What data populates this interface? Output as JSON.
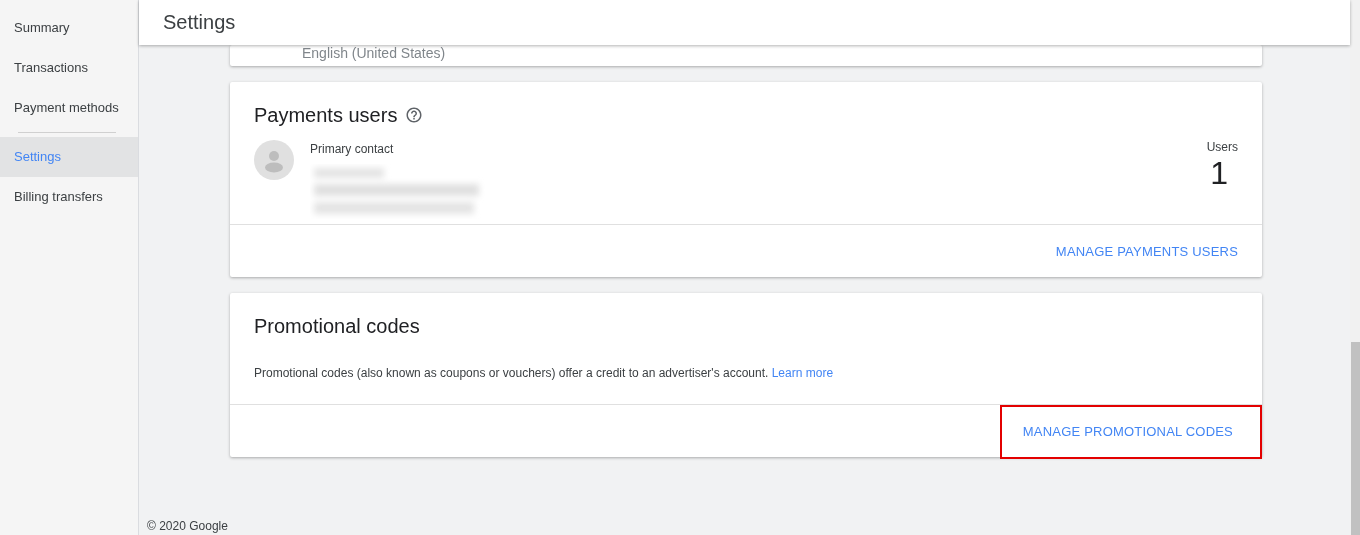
{
  "sidebar": {
    "items": [
      {
        "label": "Summary",
        "selected": false
      },
      {
        "label": "Transactions",
        "selected": false
      },
      {
        "label": "Payment methods",
        "selected": false,
        "divider_after": true
      },
      {
        "label": "Settings",
        "selected": true
      },
      {
        "label": "Billing transfers",
        "selected": false
      }
    ]
  },
  "header": {
    "title": "Settings"
  },
  "language_card": {
    "value": "English (United States)"
  },
  "payments_users_card": {
    "title": "Payments users",
    "contact_label": "Primary contact",
    "users_label": "Users",
    "users_count": "1",
    "action": "MANAGE PAYMENTS USERS"
  },
  "promotional_codes_card": {
    "title": "Promotional codes",
    "description": "Promotional codes (also known as coupons or vouchers) offer a credit to an advertiser's account.",
    "link": "Learn more",
    "action": "MANAGE PROMOTIONAL CODES",
    "action_highlighted": true
  },
  "footer": {
    "copyright": "© 2020 Google"
  }
}
